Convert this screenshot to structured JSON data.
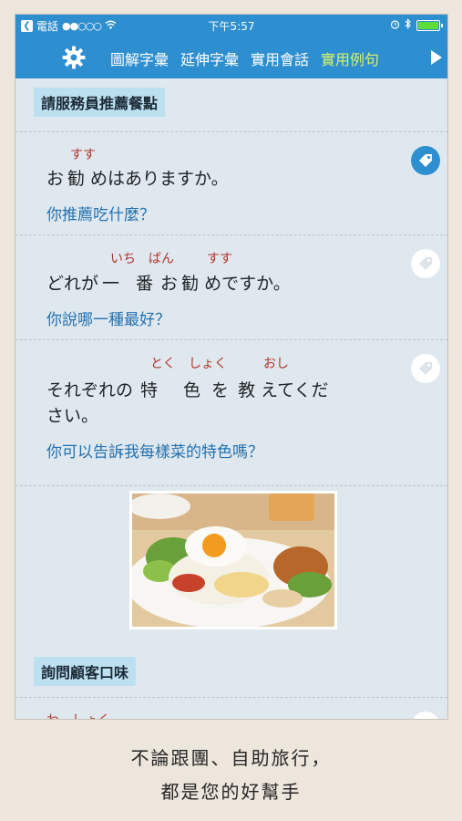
{
  "status": {
    "carrier": "電話",
    "signal_dots": "●●○○○",
    "time": "下午5:57",
    "back_icon": "back-to-app-icon"
  },
  "nav": {
    "settings_icon": "gear-icon",
    "tabs": [
      "圖解字彙",
      "延伸字彙",
      "實用會話",
      "實用例句"
    ],
    "active_tab": 3,
    "next_icon": "right-arrow-icon"
  },
  "sections": [
    {
      "title": "請服務員推薦餐點"
    },
    {
      "title": "詢問顧客口味"
    }
  ],
  "phrases": [
    {
      "jp_parts": [
        "お",
        "勧",
        "めはありますか。"
      ],
      "ruby": [
        "すす"
      ],
      "zh": "你推薦吃什麼？",
      "tagged": true
    },
    {
      "jp_parts": [
        "どれが",
        "一",
        "番",
        "お",
        "勧",
        "めですか。"
      ],
      "ruby": [
        "いち",
        "ばん",
        "すす"
      ],
      "zh": "你說哪一種最好？",
      "tagged": false
    },
    {
      "jp_parts": [
        "それぞれの",
        "特",
        "色",
        "を",
        "教",
        "えてくだ"
      ],
      "jp_line2": "さい。",
      "ruby": [
        "とく",
        "しょく",
        "おし"
      ],
      "zh": "你可以告訴我每樣菜的特色嗎？",
      "tagged": false
    },
    {
      "ruby": [
        "わ",
        "しょく"
      ],
      "tagged": false
    }
  ],
  "footer": {
    "line1": "不論跟團、自助旅行，",
    "line2": "都是您的好幫手"
  },
  "colors": {
    "accent": "#2e8fd0",
    "active_tab": "#d8f06a",
    "ruby": "#b3342a",
    "translation": "#2471b0"
  }
}
